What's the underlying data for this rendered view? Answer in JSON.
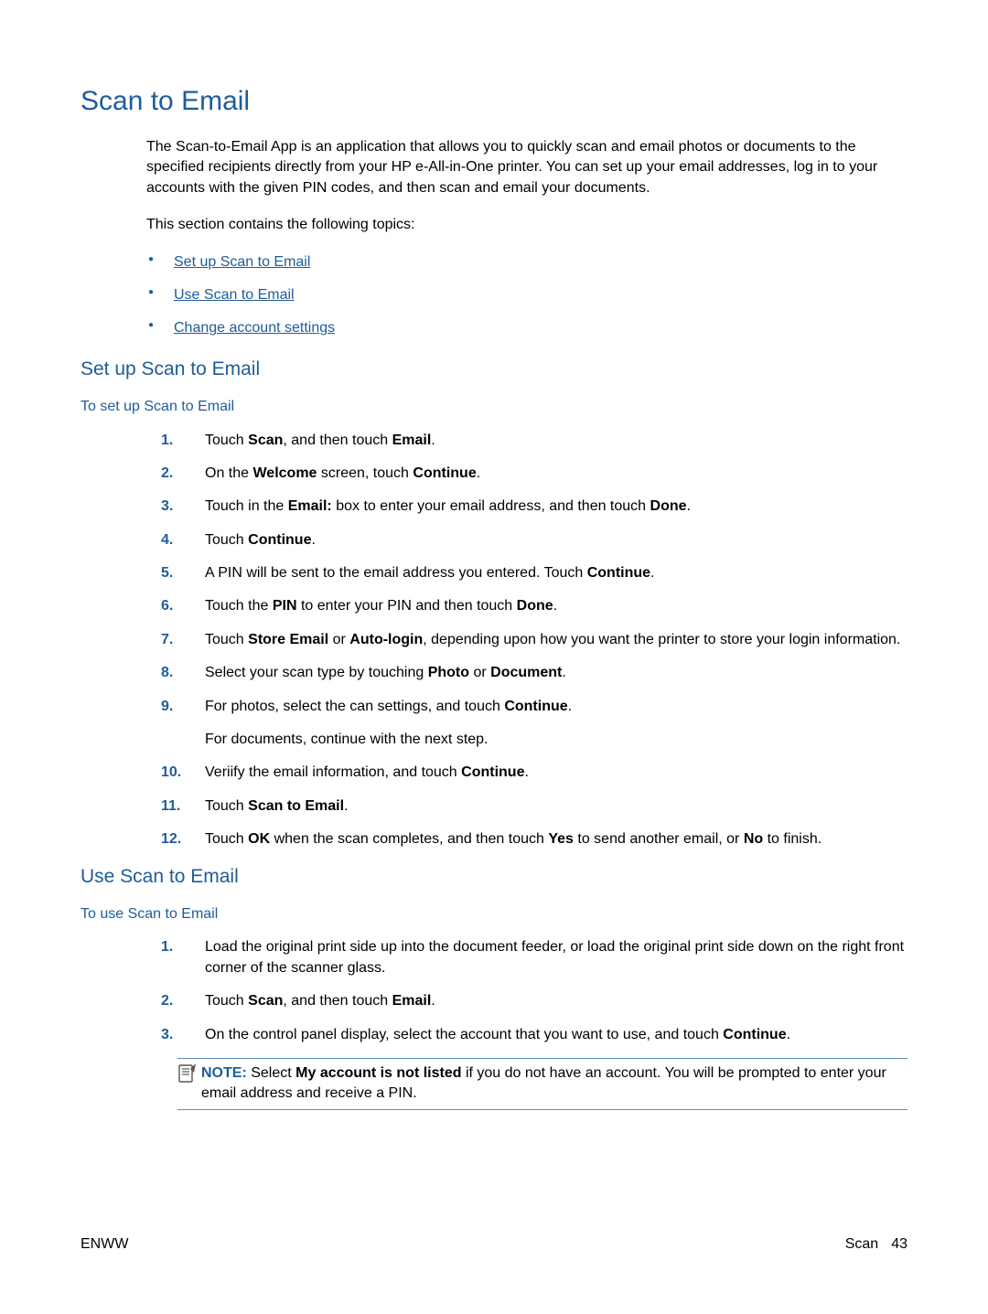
{
  "title": "Scan to Email",
  "intro": "The Scan-to-Email App is an application that allows you to quickly scan and email photos or documents to the specified recipients directly from your HP e-All-in-One printer. You can set up your email addresses, log in to your accounts with the given PIN codes, and then scan and email your documents.",
  "topics_lead": "This section contains the following topics:",
  "topics": {
    "setup_link": "Set up Scan to Email",
    "use_link": "Use Scan to Email",
    "change_link": "Change account settings"
  },
  "setup": {
    "heading": "Set up Scan to Email",
    "subheading": "To set up Scan to Email",
    "steps": {
      "s1_a": "Touch ",
      "s1_b": "Scan",
      "s1_c": ", and then touch ",
      "s1_d": "Email",
      "s1_e": ".",
      "s2_a": "On the ",
      "s2_b": "Welcome",
      "s2_c": " screen, touch ",
      "s2_d": "Continue",
      "s2_e": ".",
      "s3_a": "Touch in the ",
      "s3_b": "Email:",
      "s3_c": " box to enter your email address, and then touch ",
      "s3_d": "Done",
      "s3_e": ".",
      "s4_a": "Touch ",
      "s4_b": "Continue",
      "s4_c": ".",
      "s5_a": "A PIN will be sent to the email address you entered. Touch ",
      "s5_b": "Continue",
      "s5_c": ".",
      "s6_a": "Touch the ",
      "s6_b": "PIN",
      "s6_c": " to enter your PIN and then touch ",
      "s6_d": "Done",
      "s6_e": ".",
      "s7_a": "Touch ",
      "s7_b": "Store Email",
      "s7_c": " or ",
      "s7_d": "Auto-login",
      "s7_e": ", depending upon how you want the printer to store your login information.",
      "s8_a": "Select your scan type by touching ",
      "s8_b": "Photo",
      "s8_c": " or ",
      "s8_d": "Document",
      "s8_e": ".",
      "s9_a": "For photos, select the can settings, and touch ",
      "s9_b": "Continue",
      "s9_c": ".",
      "s9_sub": "For documents, continue with the next step.",
      "s10_a": "Veriify the email information, and touch ",
      "s10_b": "Continue",
      "s10_c": ".",
      "s11_a": "Touch ",
      "s11_b": "Scan to Email",
      "s11_c": ".",
      "s12_a": "Touch ",
      "s12_b": "OK",
      "s12_c": " when the scan completes, and then touch ",
      "s12_d": "Yes",
      "s12_e": " to send another email, or ",
      "s12_f": "No",
      "s12_g": " to finish."
    }
  },
  "use": {
    "heading": "Use Scan to Email",
    "subheading": "To use Scan to Email",
    "steps": {
      "u1": "Load the original print side up into the document feeder, or load the original print side down on the right front corner of the scanner glass.",
      "u2_a": "Touch ",
      "u2_b": "Scan",
      "u2_c": ", and then touch ",
      "u2_d": "Email",
      "u2_e": ".",
      "u3_a": "On the control panel display, select the account that you want to use, and touch ",
      "u3_b": "Continue",
      "u3_c": "."
    },
    "note_label": "NOTE:",
    "note_a": "   Select ",
    "note_b": "My account is not listed",
    "note_c": " if you do not have an account. You will be prompted to enter your email address and receive a PIN."
  },
  "footer": {
    "left": "ENWW",
    "section": "Scan",
    "page": "43"
  }
}
